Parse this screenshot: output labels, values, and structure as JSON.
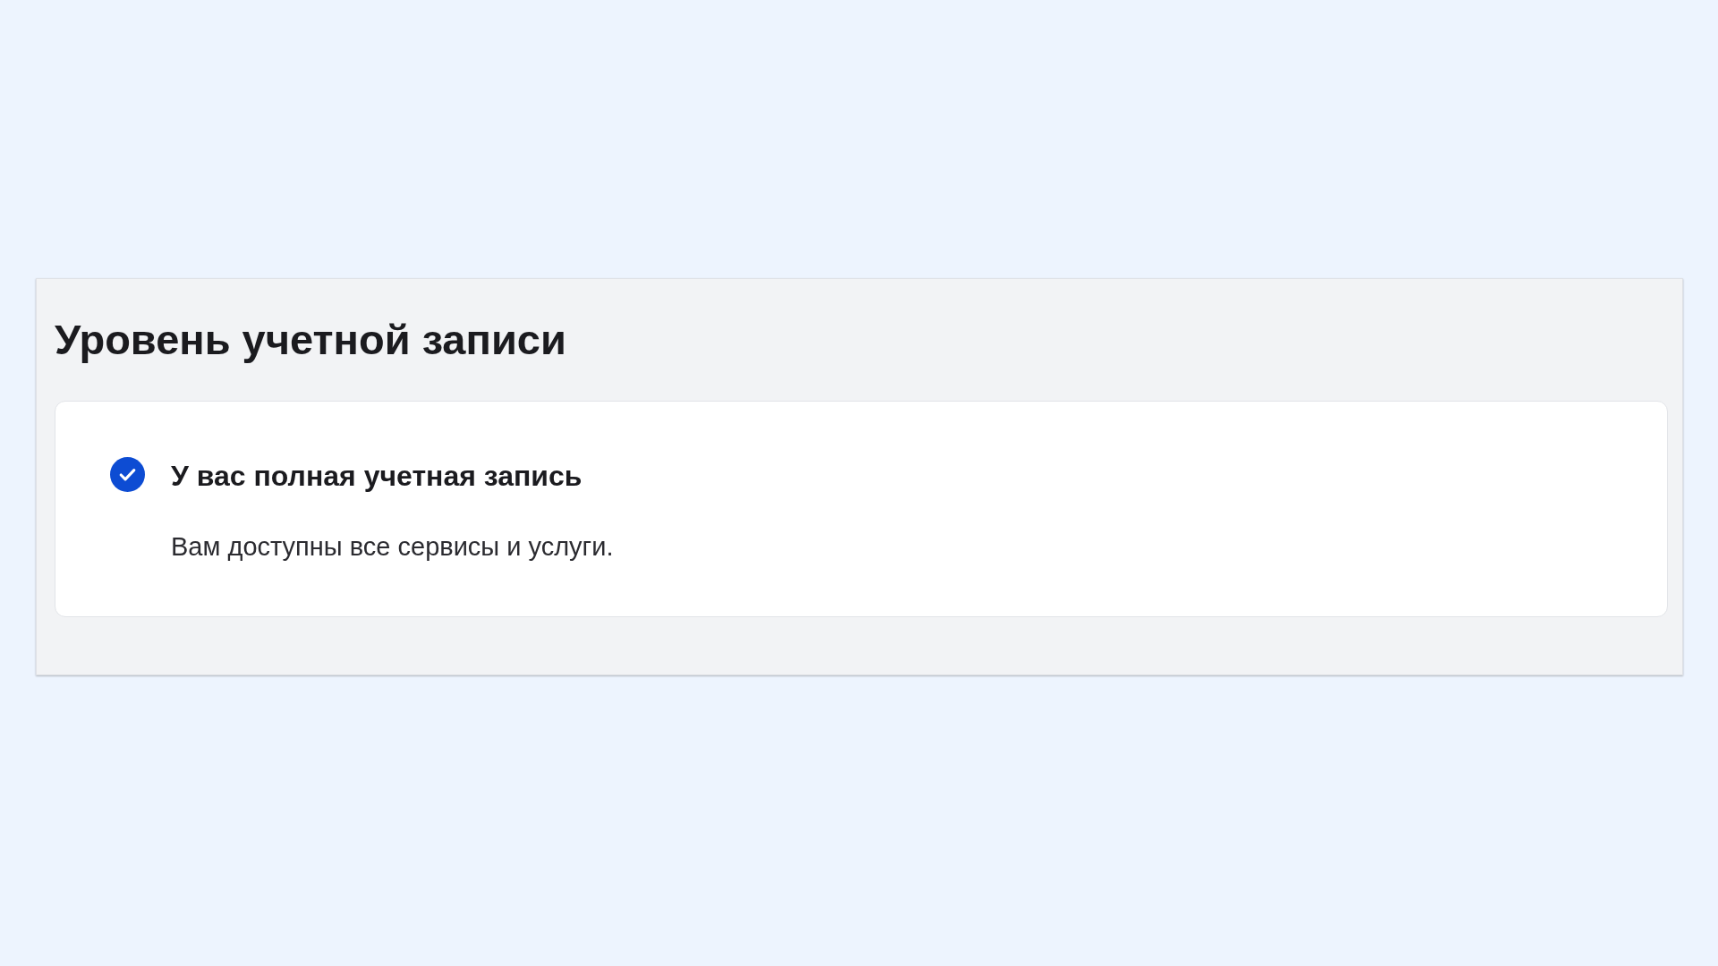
{
  "section": {
    "title": "Уровень учетной записи",
    "status_card": {
      "confirmed": true,
      "heading": "У вас полная учетная запись",
      "description": "Вам доступны все сервисы и услуги."
    }
  }
}
